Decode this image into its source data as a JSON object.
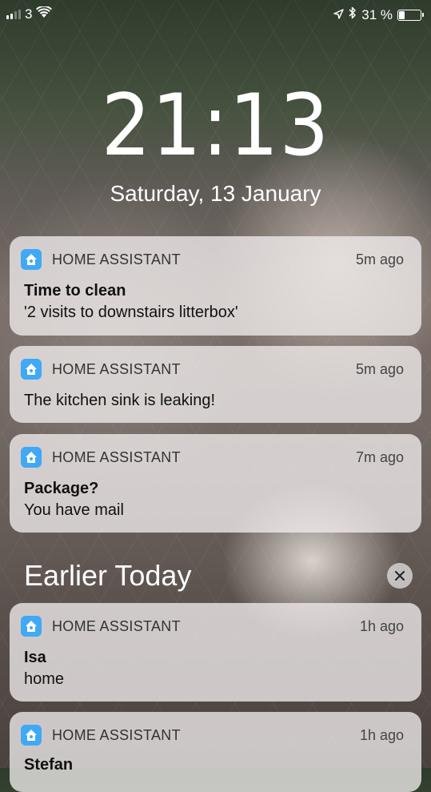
{
  "status_bar": {
    "carrier": "3",
    "battery_percent_text": "31 %",
    "battery_level": 0.31,
    "signal_bars_active": 2,
    "signal_bars_total": 4
  },
  "lock_screen": {
    "time": "21:13",
    "date": "Saturday, 13 January"
  },
  "notifications": [
    {
      "app": "HOME ASSISTANT",
      "time_ago": "5m ago",
      "title": "Time to clean",
      "body": "'2 visits to downstairs litterbox'"
    },
    {
      "app": "HOME ASSISTANT",
      "time_ago": "5m ago",
      "title": "",
      "body": "The kitchen sink is leaking!"
    },
    {
      "app": "HOME ASSISTANT",
      "time_ago": "7m ago",
      "title": "Package?",
      "body": "You have mail"
    }
  ],
  "earlier": {
    "section_title": "Earlier Today",
    "notifications": [
      {
        "app": "HOME ASSISTANT",
        "time_ago": "1h ago",
        "title": "Isa",
        "body": "home"
      },
      {
        "app": "HOME ASSISTANT",
        "time_ago": "1h ago",
        "title": "Stefan",
        "body": ""
      }
    ]
  },
  "icons": {
    "app": "home-assistant-icon",
    "clear": "close-icon",
    "wifi": "wifi-icon",
    "location": "location-arrow-icon",
    "bluetooth": "bluetooth-icon",
    "battery": "battery-icon"
  },
  "colors": {
    "app_icon": "#3fa9f5"
  }
}
